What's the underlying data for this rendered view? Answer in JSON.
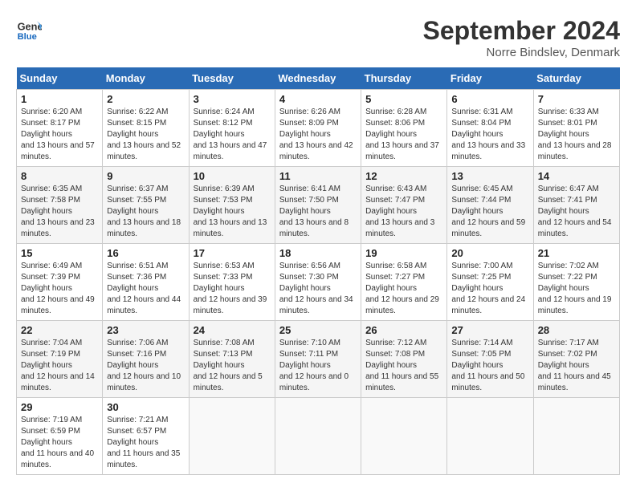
{
  "header": {
    "logo_line1": "General",
    "logo_line2": "Blue",
    "title": "September 2024",
    "location": "Norre Bindslev, Denmark"
  },
  "weekdays": [
    "Sunday",
    "Monday",
    "Tuesday",
    "Wednesday",
    "Thursday",
    "Friday",
    "Saturday"
  ],
  "weeks": [
    [
      {
        "day": "1",
        "sunrise": "6:20 AM",
        "sunset": "8:17 PM",
        "daylight": "13 hours and 57 minutes."
      },
      {
        "day": "2",
        "sunrise": "6:22 AM",
        "sunset": "8:15 PM",
        "daylight": "13 hours and 52 minutes."
      },
      {
        "day": "3",
        "sunrise": "6:24 AM",
        "sunset": "8:12 PM",
        "daylight": "13 hours and 47 minutes."
      },
      {
        "day": "4",
        "sunrise": "6:26 AM",
        "sunset": "8:09 PM",
        "daylight": "13 hours and 42 minutes."
      },
      {
        "day": "5",
        "sunrise": "6:28 AM",
        "sunset": "8:06 PM",
        "daylight": "13 hours and 37 minutes."
      },
      {
        "day": "6",
        "sunrise": "6:31 AM",
        "sunset": "8:04 PM",
        "daylight": "13 hours and 33 minutes."
      },
      {
        "day": "7",
        "sunrise": "6:33 AM",
        "sunset": "8:01 PM",
        "daylight": "13 hours and 28 minutes."
      }
    ],
    [
      {
        "day": "8",
        "sunrise": "6:35 AM",
        "sunset": "7:58 PM",
        "daylight": "13 hours and 23 minutes."
      },
      {
        "day": "9",
        "sunrise": "6:37 AM",
        "sunset": "7:55 PM",
        "daylight": "13 hours and 18 minutes."
      },
      {
        "day": "10",
        "sunrise": "6:39 AM",
        "sunset": "7:53 PM",
        "daylight": "13 hours and 13 minutes."
      },
      {
        "day": "11",
        "sunrise": "6:41 AM",
        "sunset": "7:50 PM",
        "daylight": "13 hours and 8 minutes."
      },
      {
        "day": "12",
        "sunrise": "6:43 AM",
        "sunset": "7:47 PM",
        "daylight": "13 hours and 3 minutes."
      },
      {
        "day": "13",
        "sunrise": "6:45 AM",
        "sunset": "7:44 PM",
        "daylight": "12 hours and 59 minutes."
      },
      {
        "day": "14",
        "sunrise": "6:47 AM",
        "sunset": "7:41 PM",
        "daylight": "12 hours and 54 minutes."
      }
    ],
    [
      {
        "day": "15",
        "sunrise": "6:49 AM",
        "sunset": "7:39 PM",
        "daylight": "12 hours and 49 minutes."
      },
      {
        "day": "16",
        "sunrise": "6:51 AM",
        "sunset": "7:36 PM",
        "daylight": "12 hours and 44 minutes."
      },
      {
        "day": "17",
        "sunrise": "6:53 AM",
        "sunset": "7:33 PM",
        "daylight": "12 hours and 39 minutes."
      },
      {
        "day": "18",
        "sunrise": "6:56 AM",
        "sunset": "7:30 PM",
        "daylight": "12 hours and 34 minutes."
      },
      {
        "day": "19",
        "sunrise": "6:58 AM",
        "sunset": "7:27 PM",
        "daylight": "12 hours and 29 minutes."
      },
      {
        "day": "20",
        "sunrise": "7:00 AM",
        "sunset": "7:25 PM",
        "daylight": "12 hours and 24 minutes."
      },
      {
        "day": "21",
        "sunrise": "7:02 AM",
        "sunset": "7:22 PM",
        "daylight": "12 hours and 19 minutes."
      }
    ],
    [
      {
        "day": "22",
        "sunrise": "7:04 AM",
        "sunset": "7:19 PM",
        "daylight": "12 hours and 14 minutes."
      },
      {
        "day": "23",
        "sunrise": "7:06 AM",
        "sunset": "7:16 PM",
        "daylight": "12 hours and 10 minutes."
      },
      {
        "day": "24",
        "sunrise": "7:08 AM",
        "sunset": "7:13 PM",
        "daylight": "12 hours and 5 minutes."
      },
      {
        "day": "25",
        "sunrise": "7:10 AM",
        "sunset": "7:11 PM",
        "daylight": "12 hours and 0 minutes."
      },
      {
        "day": "26",
        "sunrise": "7:12 AM",
        "sunset": "7:08 PM",
        "daylight": "11 hours and 55 minutes."
      },
      {
        "day": "27",
        "sunrise": "7:14 AM",
        "sunset": "7:05 PM",
        "daylight": "11 hours and 50 minutes."
      },
      {
        "day": "28",
        "sunrise": "7:17 AM",
        "sunset": "7:02 PM",
        "daylight": "11 hours and 45 minutes."
      }
    ],
    [
      {
        "day": "29",
        "sunrise": "7:19 AM",
        "sunset": "6:59 PM",
        "daylight": "11 hours and 40 minutes."
      },
      {
        "day": "30",
        "sunrise": "7:21 AM",
        "sunset": "6:57 PM",
        "daylight": "11 hours and 35 minutes."
      },
      null,
      null,
      null,
      null,
      null
    ]
  ]
}
